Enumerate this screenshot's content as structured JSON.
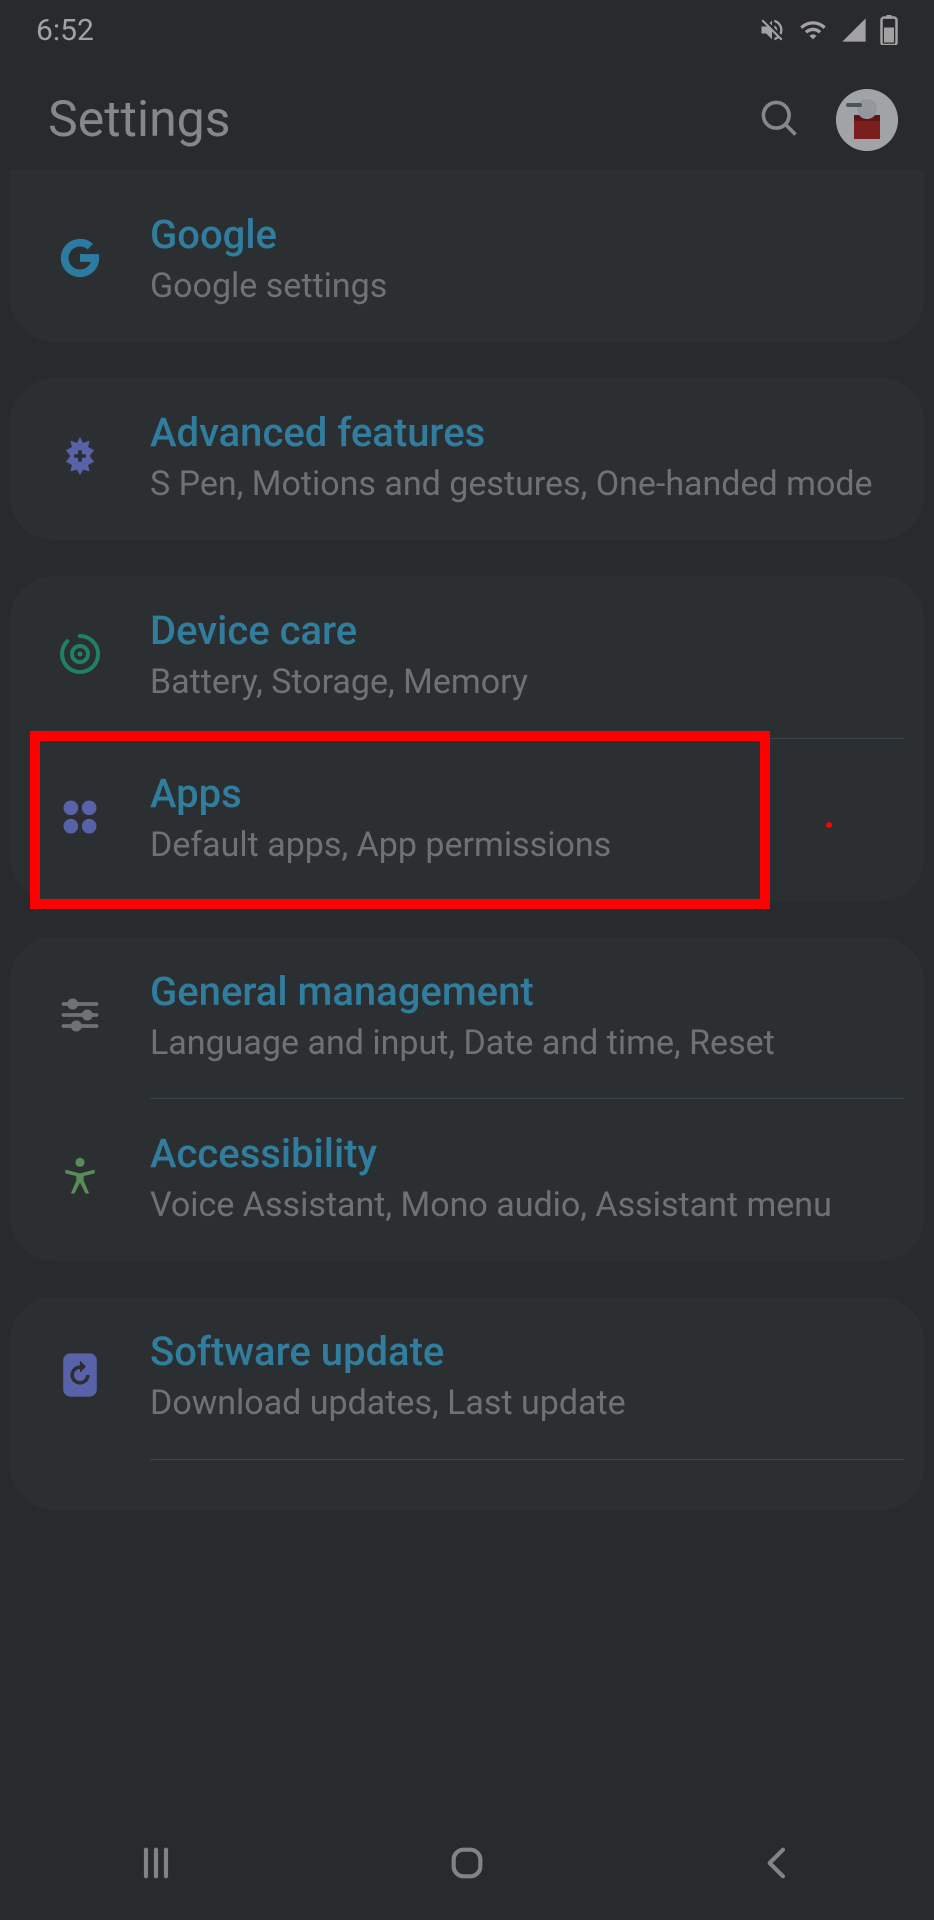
{
  "status": {
    "time": "6:52"
  },
  "header": {
    "title": "Settings"
  },
  "groups": [
    {
      "items": [
        {
          "id": "google",
          "title": "Google",
          "subtitle": "Google settings",
          "icon": "google-icon"
        }
      ]
    },
    {
      "items": [
        {
          "id": "advanced",
          "title": "Advanced features",
          "subtitle": "S Pen, Motions and gestures, One-handed mode",
          "icon": "advanced-features-icon"
        }
      ]
    },
    {
      "items": [
        {
          "id": "devicecare",
          "title": "Device care",
          "subtitle": "Battery, Storage, Memory",
          "icon": "device-care-icon"
        },
        {
          "id": "apps",
          "title": "Apps",
          "subtitle": "Default apps, App permissions",
          "icon": "apps-icon",
          "highlighted": true
        }
      ]
    },
    {
      "items": [
        {
          "id": "general",
          "title": "General management",
          "subtitle": "Language and input, Date and time, Reset",
          "icon": "sliders-icon"
        },
        {
          "id": "accessibility",
          "title": "Accessibility",
          "subtitle": "Voice Assistant, Mono audio, Assistant menu",
          "icon": "accessibility-icon"
        }
      ]
    },
    {
      "items": [
        {
          "id": "software",
          "title": "Software update",
          "subtitle": "Download updates, Last update",
          "icon": "software-update-icon"
        },
        {
          "id": "partial",
          "title": "",
          "subtitle": "",
          "icon": "",
          "partial": true
        }
      ]
    }
  ],
  "colors": {
    "accent": "#45b4e3",
    "highlight": "#ff0000"
  }
}
